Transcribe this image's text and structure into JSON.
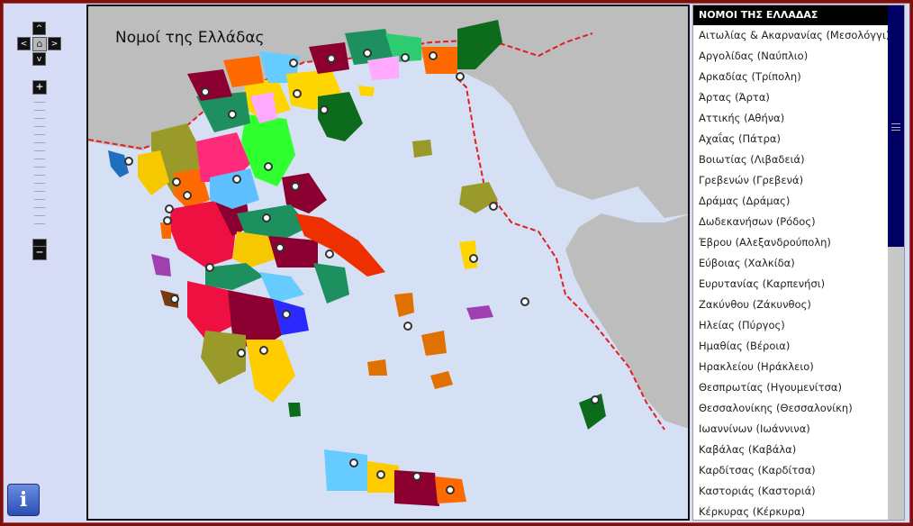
{
  "map": {
    "title": "Νομοί της Ελλάδας",
    "colors": {
      "sea": "#d5e0f4",
      "land_foreign": "#bdbdbd",
      "border": "#e02020"
    }
  },
  "controls": {
    "nav_up": "^",
    "nav_down": "v",
    "nav_left": "<",
    "nav_right": ">",
    "home_icon": "⌂",
    "zoom_in": "+",
    "zoom_out": "−",
    "info": "i"
  },
  "list": {
    "header": "ΝΟΜΟΙ ΤΗΣ ΕΛΛΑΔΑΣ",
    "items": [
      "Αιτωλίας & Ακαρνανίας (Μεσολόγγι)",
      "Αργολίδας (Ναύπλιο)",
      "Αρκαδίας (Τρίπολη)",
      "Άρτας (Άρτα)",
      "Αττικής (Αθήνα)",
      "Αχαΐας (Πάτρα)",
      "Βοιωτίας (Λιβαδειά)",
      "Γρεβενών (Γρεβενά)",
      "Δράμας (Δράμας)",
      "Δωδεκανήσων (Ρόδος)",
      "Έβρου (Αλεξανδρούπολη)",
      "Εύβοιας (Χαλκίδα)",
      "Ευρυτανίας (Καρπενήσι)",
      "Ζακύνθου (Ζάκυνθος)",
      "Ηλείας (Πύργος)",
      "Ημαθίας (Βέροια)",
      "Ηρακλείου (Ηράκλειο)",
      "Θεσπρωτίας (Ηγουμενίτσα)",
      "Θεσσαλονίκης (Θεσσαλονίκη)",
      "Ιωαννίνων (Ιωάννινα)",
      "Καβάλας (Καβάλα)",
      "Καρδίτσας (Καρδίτσα)",
      "Καστοριάς (Καστοριά)",
      "Κέρκυρας (Κέρκυρα)"
    ]
  }
}
